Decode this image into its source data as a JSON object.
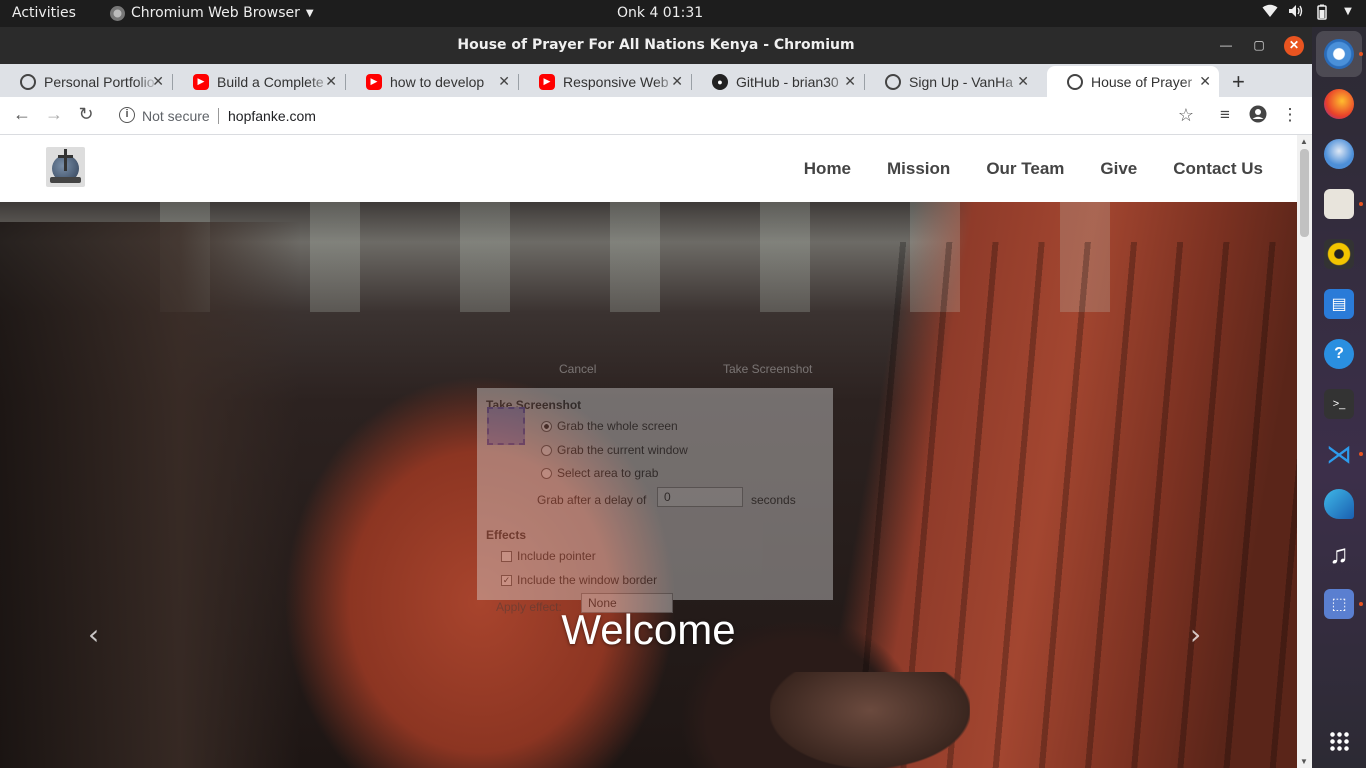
{
  "system": {
    "activities": "Activities",
    "app_menu": "Chromium Web Browser",
    "clock": "Onk 4  01:31"
  },
  "window": {
    "title": "House of Prayer For All Nations Kenya - Chromium"
  },
  "tabs": [
    {
      "label": "Personal Portfolio",
      "icon": "globe-icon"
    },
    {
      "label": "Build a Complete",
      "icon": "youtube-icon"
    },
    {
      "label": "how to develop",
      "icon": "youtube-icon"
    },
    {
      "label": "Responsive Web",
      "icon": "youtube-icon"
    },
    {
      "label": "GitHub - brian30",
      "icon": "github-icon"
    },
    {
      "label": "Sign Up - VanHa",
      "icon": "globe-icon"
    },
    {
      "label": "House of Prayer",
      "icon": "globe-icon",
      "active": true
    }
  ],
  "omnibox": {
    "security": "Not secure",
    "url": "hopfanke.com"
  },
  "site": {
    "nav": [
      "Home",
      "Mission",
      "Our Team",
      "Give",
      "Contact Us"
    ],
    "hero_caption": "Welcome"
  },
  "screenshot_dialog": {
    "cancel": "Cancel",
    "take": "Take Screenshot",
    "section_title": "Take Screenshot",
    "options": [
      "Grab the whole screen",
      "Grab the current window",
      "Select area to grab"
    ],
    "selected_option": "Grab the whole screen",
    "delay_label": "Grab after a delay of",
    "delay_value": "0",
    "delay_unit": "seconds",
    "effects_title": "Effects",
    "include_pointer": "Include pointer",
    "include_border": "Include the window border",
    "apply_effect_label": "Apply effect:",
    "apply_effect_value": "None"
  },
  "dock": {
    "items": [
      "chromium-icon",
      "firefox-icon",
      "thunderbird-icon",
      "files-icon",
      "rhythmbox-icon",
      "writer-icon",
      "help-icon",
      "terminal-icon",
      "vscode-icon",
      "edge-icon",
      "music-icon",
      "screenshot-icon"
    ]
  },
  "colors": {
    "accent": "#e95420",
    "topbar": "#1d1d1d",
    "titlebar": "#2b2b2b",
    "tabstrip": "#dee1e6"
  }
}
